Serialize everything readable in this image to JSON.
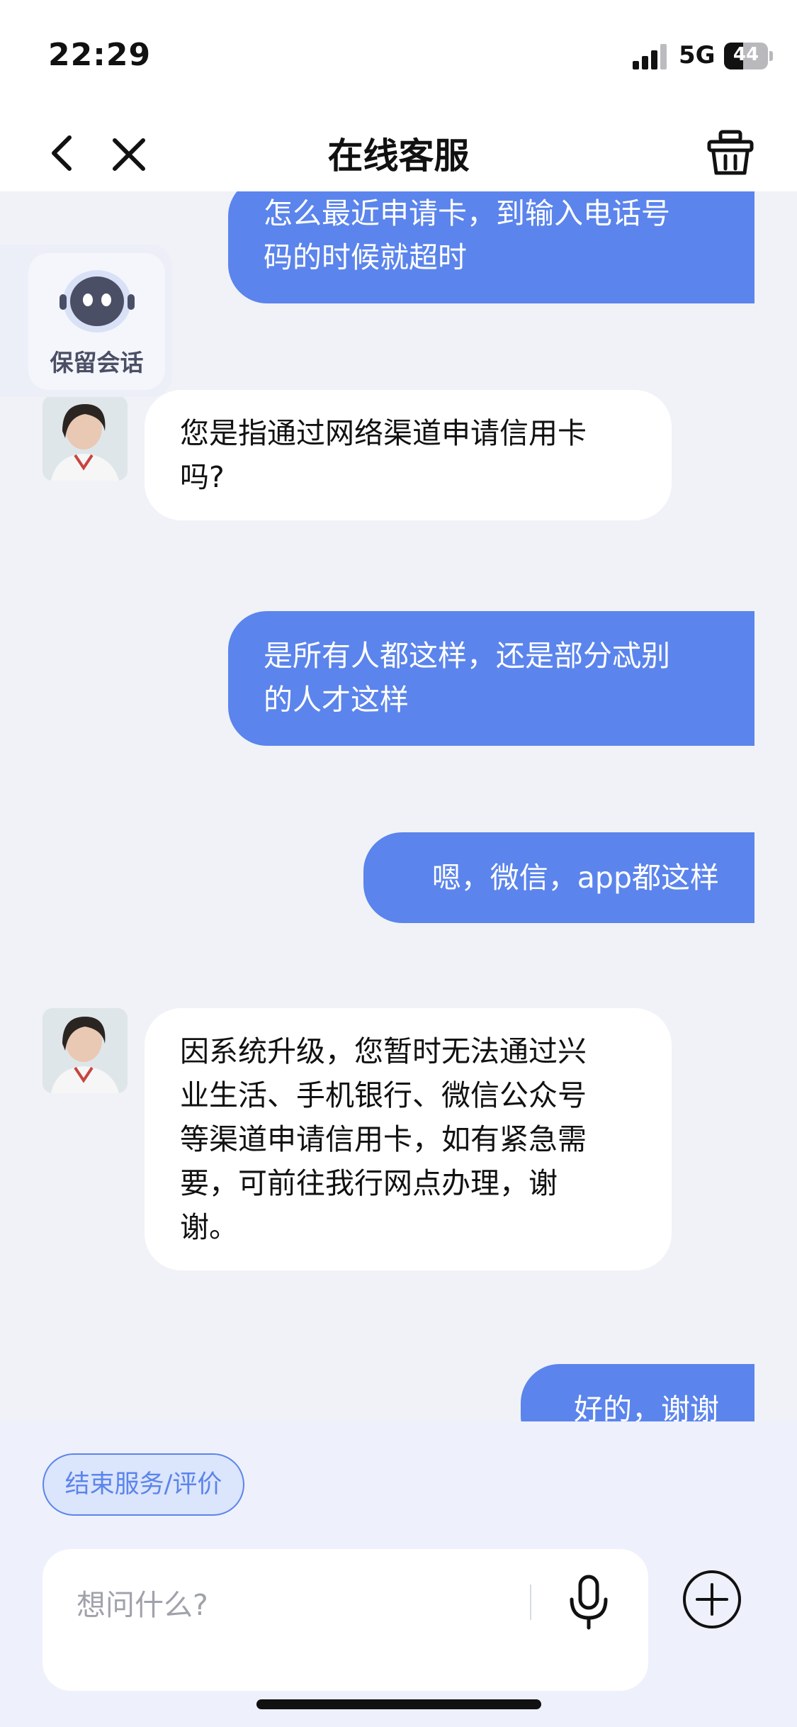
{
  "status_bar": {
    "time": "22:29",
    "network": "5G",
    "battery": "44",
    "battery_fraction": 0.44
  },
  "nav": {
    "title": "在线客服"
  },
  "keep_session": {
    "label": "保留会话"
  },
  "messages": [
    {
      "from": "user",
      "lines": [
        "怎么最近申请卡，到输入电话号",
        "码的时候就超时"
      ]
    },
    {
      "from": "agent",
      "lines": [
        "您是指通过网络渠道申请信用卡",
        "吗?"
      ]
    },
    {
      "from": "user",
      "lines": [
        "是所有人都这样，还是部分忒别",
        "的人才这样"
      ]
    },
    {
      "from": "user",
      "lines": [
        "嗯，微信，app都这样"
      ]
    },
    {
      "from": "agent",
      "lines": [
        "因系统升级，您暂时无法通过兴",
        "业生活、手机银行、微信公众号",
        "等渠道申请信用卡，如有紧急需",
        "要，可前往我行网点办理，谢",
        "谢。"
      ]
    },
    {
      "from": "user",
      "lines": [
        "好的，谢谢"
      ]
    }
  ],
  "bottom": {
    "end_service_label": "结束服务/评价",
    "input_placeholder": "想问什么?"
  },
  "colors": {
    "accent": "#5b84ec",
    "background": "#f0f2f7",
    "agent_bubble": "#ffffff"
  }
}
